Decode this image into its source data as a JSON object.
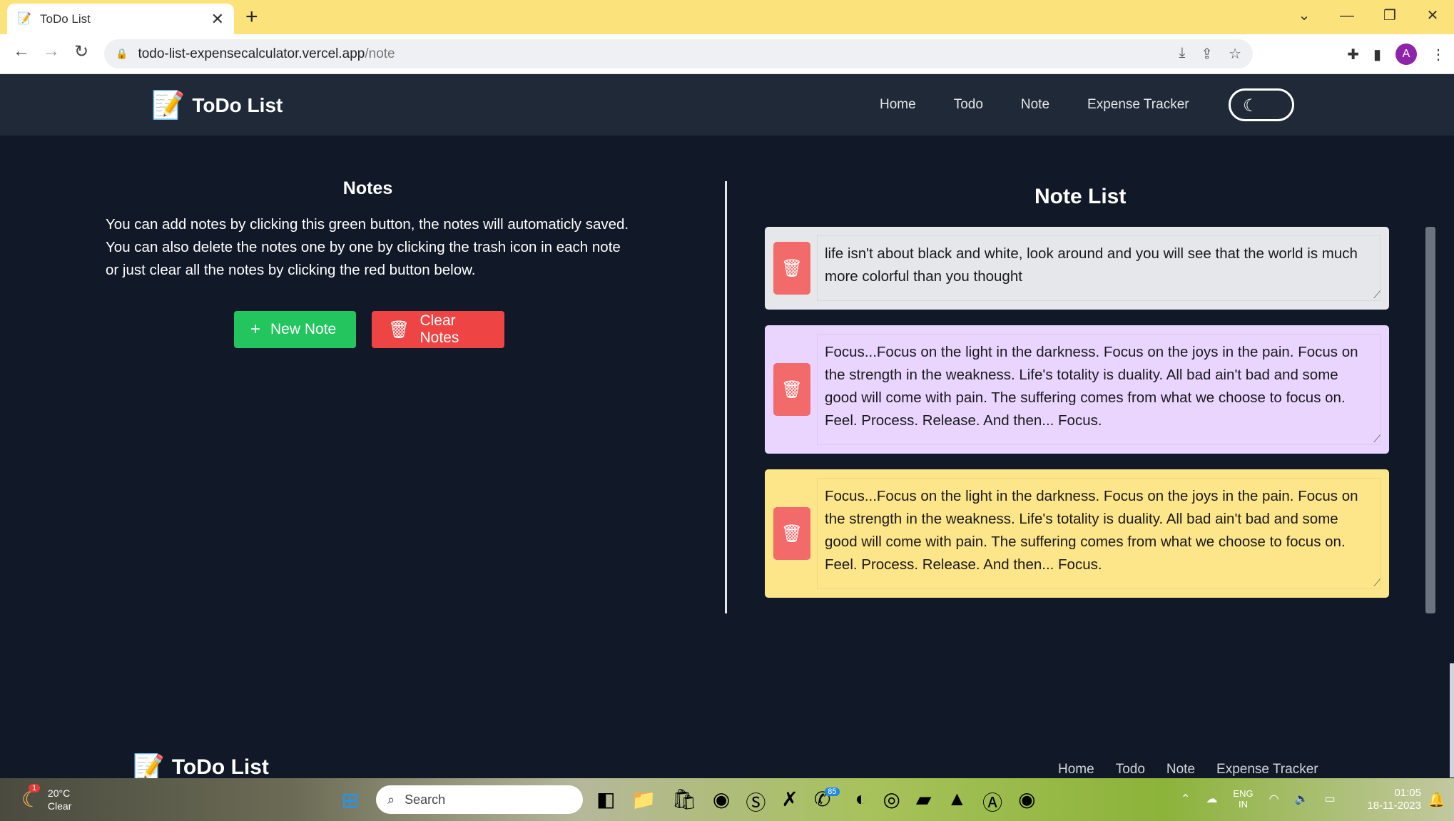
{
  "browser": {
    "tab_title": "ToDo List",
    "url_host": "todo-list-expensecalculator.vercel.app",
    "url_path": "/note",
    "profile_initial": "A"
  },
  "header": {
    "brand": "ToDo List",
    "nav": [
      "Home",
      "Todo",
      "Note",
      "Expense Tracker"
    ]
  },
  "notes_panel": {
    "title": "Notes",
    "description": "You can add notes by clicking this green button, the notes will automaticly saved. You can also delete the notes one by one by clicking the trash icon in each note or just clear all the notes by clicking the red button below.",
    "new_note_label": "New Note",
    "clear_notes_label": "Clear Notes"
  },
  "note_list": {
    "title": "Note List",
    "notes": [
      {
        "text": "life isn't about black and white, look around and you will see that the world is much more colorful than you thought",
        "color": "#e5e7eb"
      },
      {
        "text": "Focus...Focus on the light in the darkness. Focus on the joys in the pain. Focus on the strength in the weakness. Life's totality is duality. All bad ain't bad and some good will come with pain. The suffering comes from what we choose to focus on. Feel. Process. Release. And then... Focus.",
        "color": "#e9d5ff"
      },
      {
        "text": "Focus...Focus on the light in the darkness. Focus on the joys in the pain. Focus on the strength in the weakness. Life's totality is duality. All bad ain't bad and some good will come with pain. The suffering comes from what we choose to focus on. Feel. Process. Release. And then... Focus.",
        "color": "#fde68a"
      }
    ]
  },
  "footer": {
    "brand": "ToDo List",
    "nav": [
      "Home",
      "Todo",
      "Note",
      "Expense Tracker"
    ]
  },
  "taskbar": {
    "weather_temp": "20°C",
    "weather_cond": "Clear",
    "weather_badge": "1",
    "search_label": "Search",
    "whatsapp_badge": "85",
    "lang": "ENG",
    "region": "IN",
    "time": "01:05",
    "date": "18-11-2023"
  },
  "colors": {
    "page_bg": "#111827",
    "header_bg": "#1f2937",
    "tab_strip": "#fbe27a",
    "accent_green": "#22c55e",
    "accent_red": "#ef4444"
  }
}
